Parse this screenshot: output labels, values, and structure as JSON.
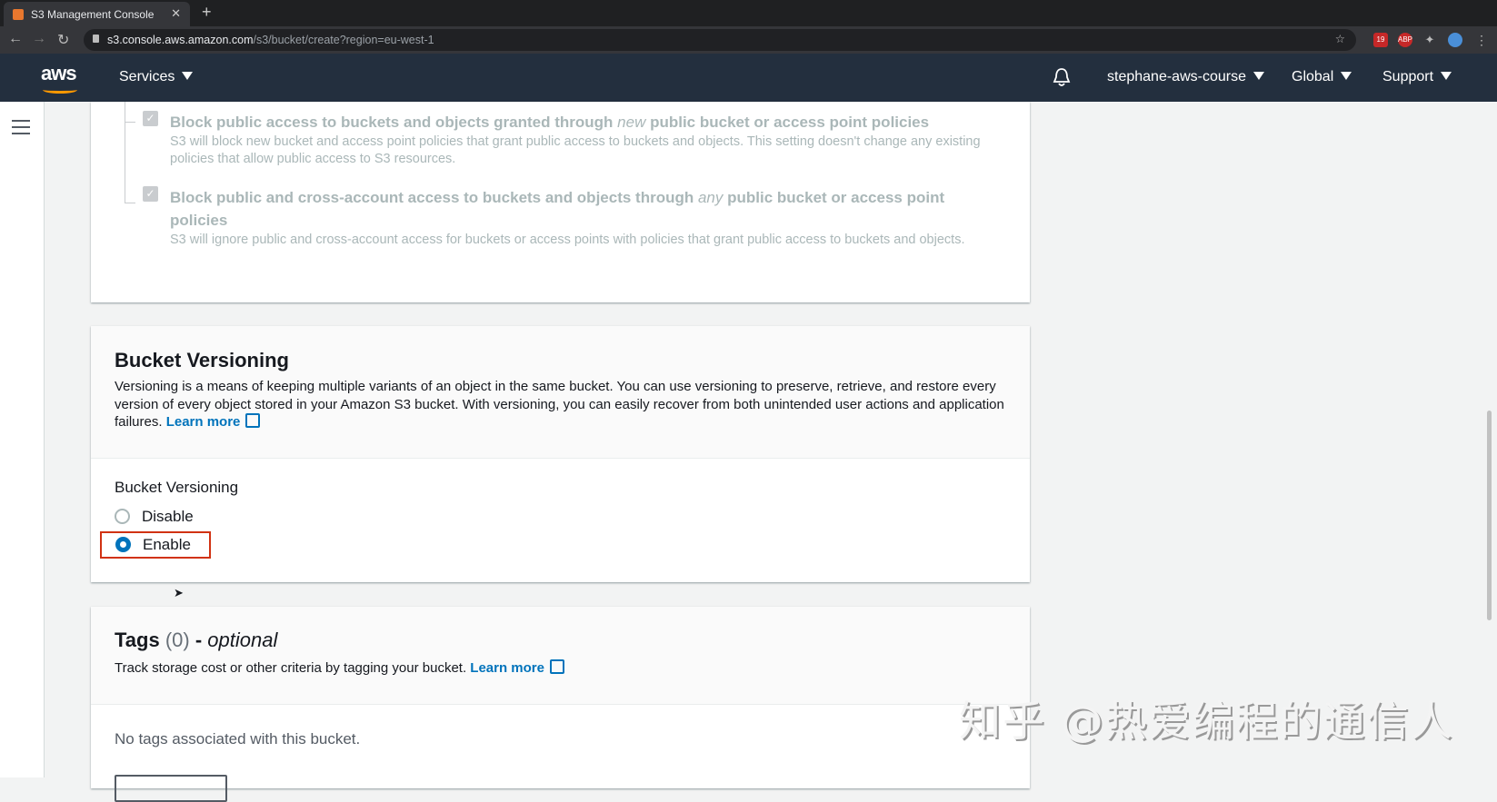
{
  "browser": {
    "tab_title": "S3 Management Console",
    "url_host": "s3.console.aws.amazon.com",
    "url_path": "/s3/bucket/create?region=eu-west-1",
    "ext_badge": "19",
    "abp": "ABP"
  },
  "nav": {
    "services": "Services",
    "account": "stephane-aws-course",
    "region": "Global",
    "support": "Support"
  },
  "block_public": {
    "item3": {
      "title_a": "Block public access to buckets and objects granted through ",
      "title_em": "new",
      "title_b": " public bucket or access point policies",
      "desc": "S3 will block new bucket and access point policies that grant public access to buckets and objects. This setting doesn't change any existing policies that allow public access to S3 resources."
    },
    "item4": {
      "title_a": "Block public and cross-account access to buckets and objects through ",
      "title_em": "any",
      "title_b": " public bucket or access point policies",
      "desc": "S3 will ignore public and cross-account access for buckets or access points with policies that grant public access to buckets and objects."
    }
  },
  "versioning": {
    "heading": "Bucket Versioning",
    "desc": "Versioning is a means of keeping multiple variants of an object in the same bucket. You can use versioning to preserve, retrieve, and restore every version of every object stored in your Amazon S3 bucket. With versioning, you can easily recover from both unintended user actions and application failures.",
    "learn_more": "Learn more",
    "label": "Bucket Versioning",
    "options": [
      {
        "label": "Disable",
        "selected": false
      },
      {
        "label": "Enable",
        "selected": true
      }
    ]
  },
  "tags": {
    "heading": "Tags",
    "count": "(0)",
    "dash": " - ",
    "optional": "optional",
    "desc": "Track storage cost or other criteria by tagging your bucket.",
    "learn_more": "Learn more",
    "empty": "No tags associated with this bucket."
  },
  "watermark": "知乎 @热爱编程的通信人"
}
